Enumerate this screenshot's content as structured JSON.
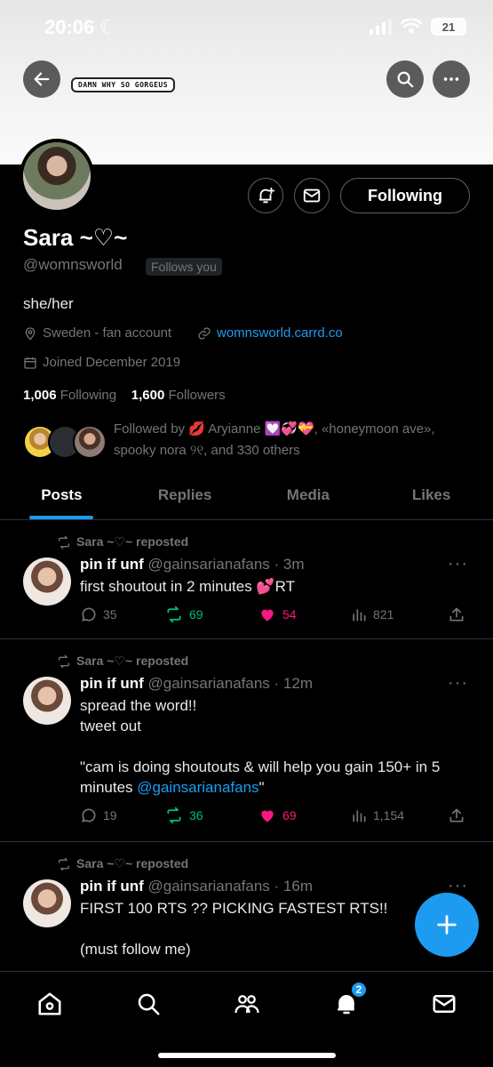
{
  "status": {
    "time": "20:06",
    "battery": "21"
  },
  "banner": {
    "sticker_text": "DAMN WHY SO GORGEUS"
  },
  "profile": {
    "name": "Sara ~♡~",
    "handle": "@womnsworld",
    "follows_you": "Follows you",
    "bio": "she/her",
    "location": "Sweden - fan account",
    "website": "womnsworld.carrd.co",
    "joined": "Joined December 2019",
    "following_count": "1,006",
    "following_label": "Following",
    "followers_count": "1,600",
    "followers_label": "Followers",
    "following_button": "Following",
    "followed_by": "Followed by 💋 Aryianne 💟💞💝, «honeymoon ave», spooky nora ୨୧, and 330 others"
  },
  "tabs": [
    "Posts",
    "Replies",
    "Media",
    "Likes"
  ],
  "tweets": [
    {
      "repost": "Sara ~♡~ reposted",
      "name": "pin if unf",
      "handle": "@gainsarianafans",
      "time": "· 3m",
      "text": "first shoutout in 2 minutes 💕RT",
      "replies": "35",
      "retweets": "69",
      "likes": "54",
      "views": "821"
    },
    {
      "repost": "Sara ~♡~ reposted",
      "name": "pin if unf",
      "handle": "@gainsarianafans",
      "time": "· 12m",
      "text_pre": "spread the word!!\ntweet out\n\n\"cam is doing shoutouts & will help you gain 150+ in 5 minutes ",
      "mention": "@gainsarianafans",
      "text_post": "\"",
      "replies": "19",
      "retweets": "36",
      "likes": "69",
      "views": "1,154"
    },
    {
      "repost": "Sara ~♡~ reposted",
      "name": "pin if unf",
      "handle": "@gainsarianafans",
      "time": "· 16m",
      "text": "FIRST 100 RTS ?? PICKING FASTEST RTS!!\n\n(must follow me)"
    }
  ],
  "nav": {
    "notifications_badge": "2"
  },
  "colors": {
    "accent": "#1d9bf0",
    "retweet": "#00ba7c",
    "like": "#f91880"
  }
}
